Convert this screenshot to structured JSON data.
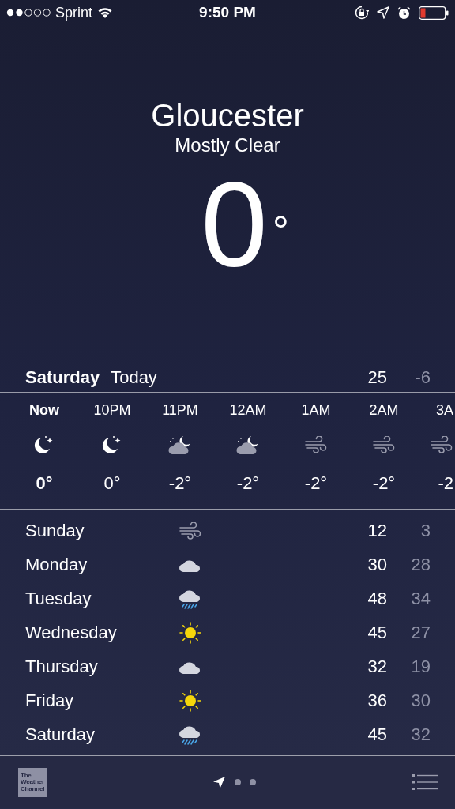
{
  "status_bar": {
    "carrier": "Sprint",
    "time": "9:50 PM"
  },
  "location": {
    "city": "Gloucester",
    "condition": "Mostly Clear",
    "temperature": "0$^{°}$"
  },
  "today": {
    "day": "Saturday",
    "label": "Today",
    "high": "25",
    "low": "-6"
  },
  "hourly": [
    {
      "time": "Now",
      "kind": "moon",
      "temp": "0°",
      "current": true
    },
    {
      "time": "10PM",
      "kind": "moon",
      "temp": "0°",
      "current": false
    },
    {
      "time": "11PM",
      "kind": "cloud-moon",
      "temp": "-2°",
      "current": false
    },
    {
      "time": "12AM",
      "kind": "cloud-moon",
      "temp": "-2°",
      "current": false
    },
    {
      "time": "1AM",
      "kind": "wind",
      "temp": "-2°",
      "current": false
    },
    {
      "time": "2AM",
      "kind": "wind",
      "temp": "-2°",
      "current": false
    },
    {
      "time": "3A",
      "kind": "wind",
      "temp": "-2",
      "current": false
    }
  ],
  "daily": [
    {
      "day": "Sunday",
      "kind": "wind",
      "high": "12",
      "low": "3"
    },
    {
      "day": "Monday",
      "kind": "cloud",
      "high": "30",
      "low": "28"
    },
    {
      "day": "Tuesday",
      "kind": "rain",
      "high": "48",
      "low": "34"
    },
    {
      "day": "Wednesday",
      "kind": "sun",
      "high": "45",
      "low": "27"
    },
    {
      "day": "Thursday",
      "kind": "cloud",
      "high": "32",
      "low": "19"
    },
    {
      "day": "Friday",
      "kind": "sun",
      "high": "36",
      "low": "30"
    },
    {
      "day": "Saturday",
      "kind": "rain",
      "high": "45",
      "low": "32"
    }
  ],
  "footer": {
    "logo_text": "The Weather Channel",
    "pages": [
      {
        "kind": "location",
        "selected": true
      },
      {
        "kind": "dot",
        "selected": false
      },
      {
        "kind": "dot",
        "selected": false
      }
    ]
  }
}
